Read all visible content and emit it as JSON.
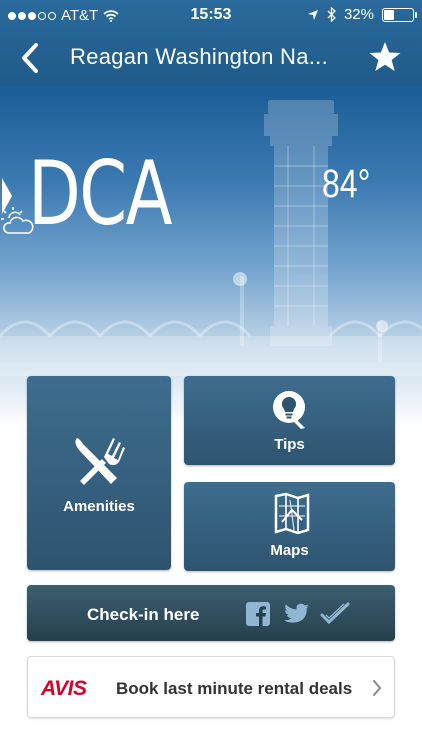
{
  "status_bar": {
    "carrier": "AT&T",
    "time": "15:53",
    "battery": "32%",
    "battery_level": 0.32,
    "signal_bars_filled": 3,
    "signal_bars_total": 5
  },
  "nav": {
    "title": "Reagan Washington Na...",
    "back_icon": "chevron-left-icon",
    "favorite_icon": "star-icon"
  },
  "hero": {
    "airport_code": "DCA",
    "temperature": "84°",
    "weather_icon": "partly-sunny-icon",
    "next_icon": "chevron-right-icon"
  },
  "tiles": {
    "amenities": {
      "label": "Amenities",
      "icon": "fork-knife-icon"
    },
    "tips": {
      "label": "Tips",
      "icon": "lightbulb-icon"
    },
    "maps": {
      "label": "Maps",
      "icon": "map-icon"
    }
  },
  "checkin": {
    "label": "Check-in here",
    "icons": [
      "facebook-icon",
      "twitter-icon",
      "foursquare-check-icon"
    ]
  },
  "ad": {
    "brand": "AVIS",
    "text": "Book last minute rental deals",
    "brand_color": "#d4002a"
  },
  "colors": {
    "nav_bar": "#1f5a89",
    "tile": "#2e5470",
    "checkin_bar": "#26404d"
  }
}
